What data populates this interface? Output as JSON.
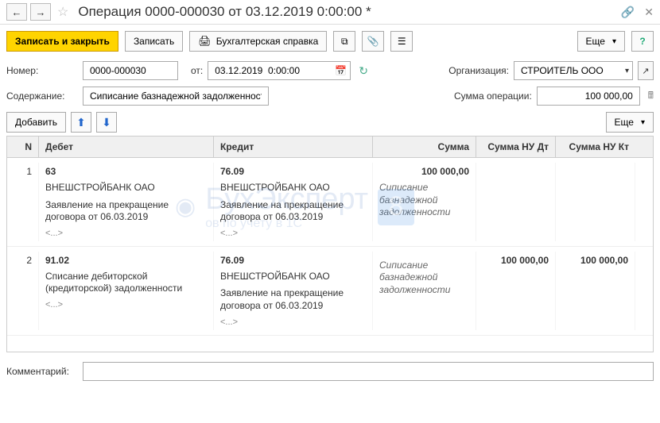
{
  "titlebar": {
    "title": "Операция 0000-000030 от 03.12.2019 0:00:00 *"
  },
  "toolbar": {
    "save_close": "Записать и закрыть",
    "save": "Записать",
    "report": "Бухгалтерская справка",
    "more": "Еще"
  },
  "form": {
    "number_label": "Номер:",
    "number_value": "0000-000030",
    "from_label": "от:",
    "date_value": "03.12.2019  0:00:00",
    "org_label": "Организация:",
    "org_value": "СТРОИТЕЛЬ ООО",
    "content_label": "Содержание:",
    "content_value": "Сиписание базнадежной задолженности",
    "sum_label": "Сумма операции:",
    "sum_value": "100 000,00",
    "comment_label": "Комментарий:",
    "comment_value": ""
  },
  "actions": {
    "add": "Добавить",
    "more": "Еще"
  },
  "grid": {
    "headers": {
      "n": "N",
      "debit": "Дебет",
      "credit": "Кредит",
      "sum": "Сумма",
      "nudt": "Сумма НУ Дт",
      "nukt": "Сумма НУ Кт"
    },
    "rows": [
      {
        "n": "1",
        "debit_acct": "63",
        "debit_sub1": "ВНЕШСТРОЙБАНК ОАО",
        "debit_sub2": "Заявление на прекращение договора от 06.03.2019",
        "debit_dots": "<...>",
        "credit_acct": "76.09",
        "credit_sub1": "ВНЕШСТРОЙБАНК ОАО",
        "credit_sub2": "Заявление на прекращение договора от 06.03.2019",
        "credit_dots": "<...>",
        "sum": "100 000,00",
        "sum_note": "Сиписание базнадежной задолженности",
        "nudt": "",
        "nukt": ""
      },
      {
        "n": "2",
        "debit_acct": "91.02",
        "debit_sub1": "Списание дебиторской (кредиторской) задолженности",
        "debit_sub2": "",
        "debit_dots": "<...>",
        "credit_acct": "76.09",
        "credit_sub1": "ВНЕШСТРОЙБАНК ОАО",
        "credit_sub2": "Заявление на прекращение договора от 06.03.2019",
        "credit_dots": "<...>",
        "sum": "",
        "sum_note": "Сиписание базнадежной задолженности",
        "nudt": "100 000,00",
        "nukt": "100 000,00"
      }
    ]
  },
  "watermark": {
    "text": "БухЭксперт",
    "sub": "ов по учету в 1С",
    "num": "8"
  }
}
